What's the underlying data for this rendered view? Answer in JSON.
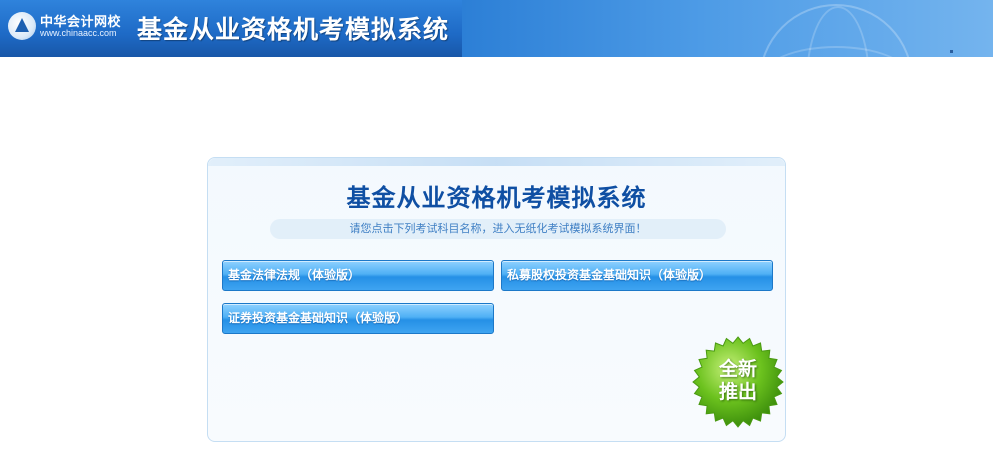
{
  "header": {
    "logo_name": "中华会计网校",
    "logo_url": "www.chinaacc.com",
    "title": "基金从业资格机考模拟系统"
  },
  "panel": {
    "title": "基金从业资格机考模拟系统",
    "subtitle": "请您点击下列考试科目名称，进入无纸化考试模拟系统界面！",
    "exams": [
      {
        "label": "基金法律法规（体验版）"
      },
      {
        "label": "私募股权投资基金基础知识（体验版）"
      },
      {
        "label": "证券投资基金基础知识（体验版）"
      }
    ],
    "badge": {
      "line1": "全新",
      "line2": "推出"
    }
  },
  "colors": {
    "header_blue": "#1a5fb4",
    "title_blue": "#0f4fa3",
    "button_blue": "#2590e6",
    "badge_green": "#5cb818"
  },
  "icons": {
    "logo": "chinaacc-logo-icon",
    "badge": "starburst-badge-icon"
  }
}
